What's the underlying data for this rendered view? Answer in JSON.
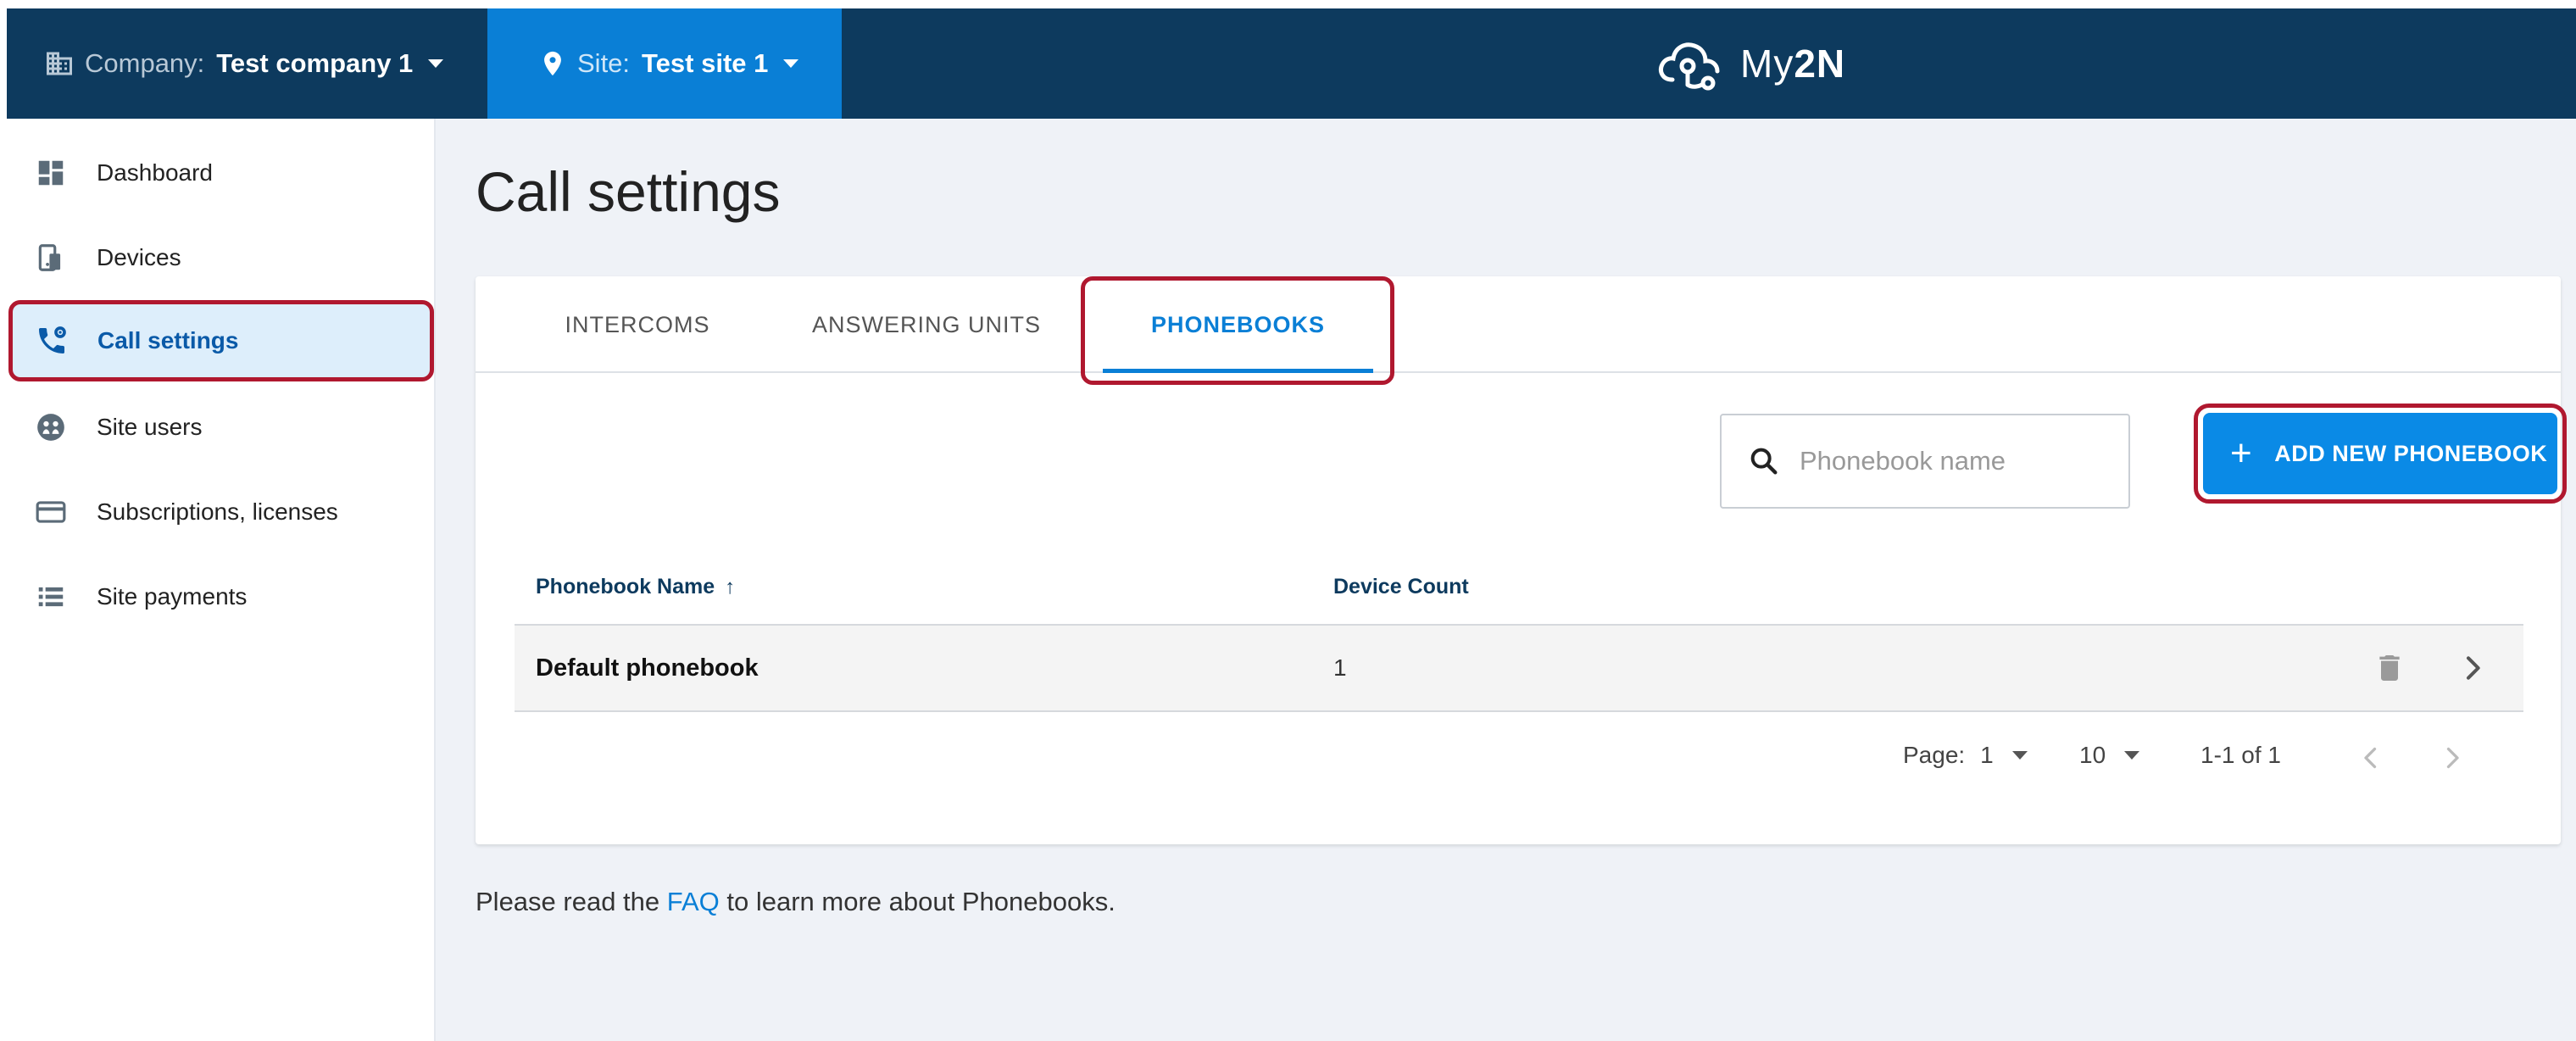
{
  "topbar": {
    "company_label": "Company:",
    "company_value": "Test company 1",
    "site_label": "Site:",
    "site_value": "Test site 1",
    "logo_text_a": "My",
    "logo_text_b": "2N",
    "colors": {
      "bar": "#0d3a5e",
      "site_bg": "#0a7fd6"
    }
  },
  "sidebar": {
    "items": [
      {
        "label": "Dashboard",
        "icon": "dashboard-icon"
      },
      {
        "label": "Devices",
        "icon": "devices-icon"
      },
      {
        "label": "Call settings",
        "icon": "call-settings-icon",
        "active": true
      },
      {
        "label": "Site users",
        "icon": "site-users-icon"
      },
      {
        "label": "Subscriptions, licenses",
        "icon": "credit-card-icon"
      },
      {
        "label": "Site payments",
        "icon": "list-icon"
      }
    ]
  },
  "main": {
    "title": "Call settings",
    "tabs": [
      {
        "label": "INTERCOMS"
      },
      {
        "label": "ANSWERING UNITS"
      },
      {
        "label": "PHONEBOOKS",
        "active": true
      }
    ],
    "search_placeholder": "Phonebook name",
    "add_button_label": "ADD NEW PHONEBOOK",
    "table": {
      "columns": [
        "Phonebook Name",
        "Device Count"
      ],
      "sort_arrow": "↑",
      "rows": [
        {
          "name": "Default phonebook",
          "count": "1"
        }
      ]
    },
    "pagination": {
      "page_label": "Page:",
      "page_value": "1",
      "per_page": "10",
      "range": "1-1 of 1"
    },
    "footer": {
      "before": "Please read the ",
      "link": "FAQ",
      "after": " to learn more about Phonebooks."
    },
    "accent_color": "#0a7fd6",
    "highlight_color": "#b0182f"
  }
}
